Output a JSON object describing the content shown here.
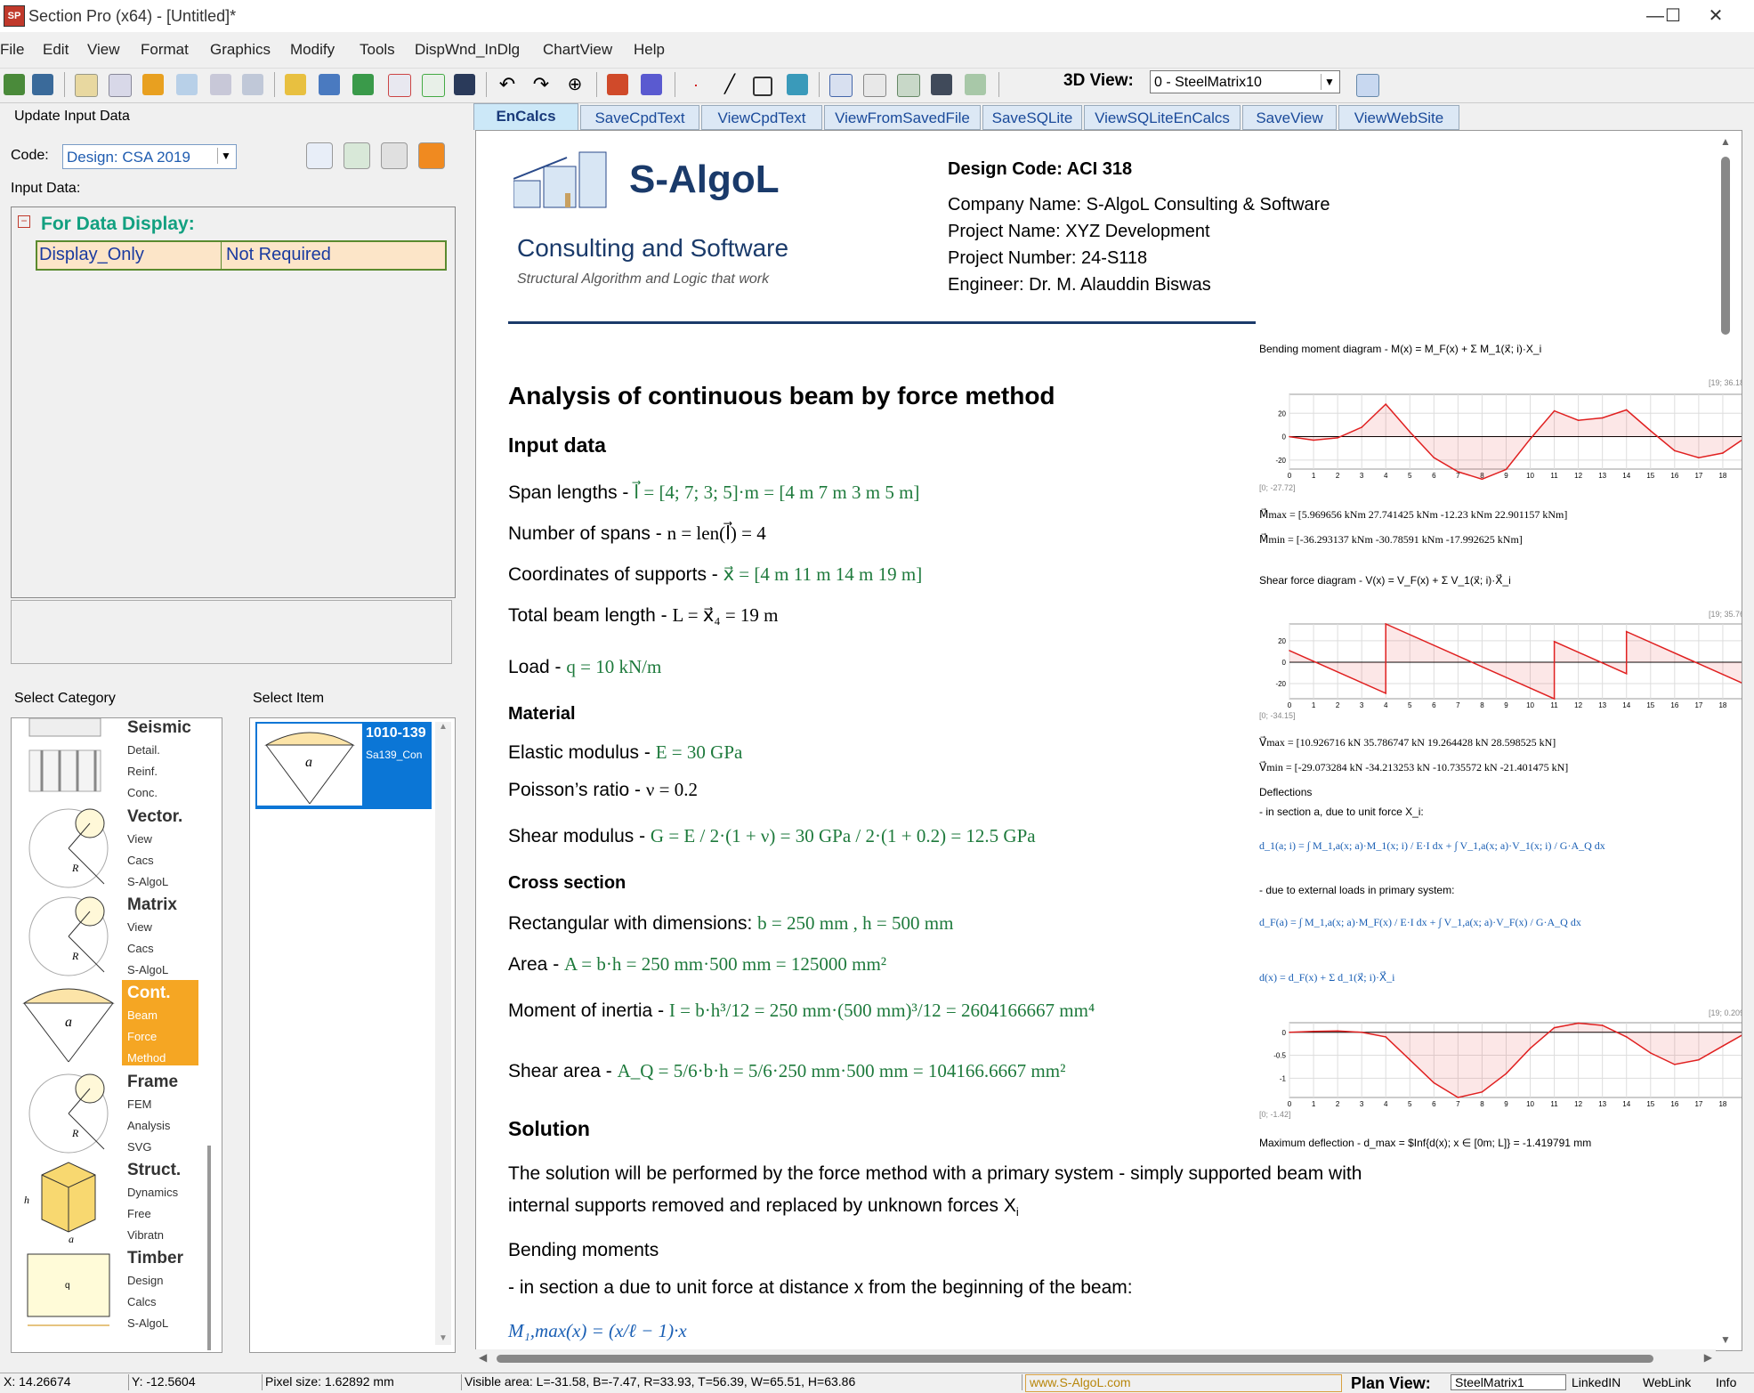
{
  "window": {
    "title": "Section Pro (x64) - [Untitled]*",
    "app_icon_text": "SP",
    "minimize": "—",
    "maximize": "☐",
    "close": "✕"
  },
  "menu": [
    "File",
    "Edit",
    "View",
    "Format",
    "Graphics",
    "Modify",
    "Tools",
    "DispWnd_InDlg",
    "ChartView",
    "Help"
  ],
  "toolbar": {
    "view3d_label": "3D View:",
    "view3d_value": "0 - SteelMatrix10"
  },
  "left": {
    "update_label": "Update Input Data",
    "code_label": "Code:",
    "code_value": "Design: CSA 2019",
    "input_data_label": "Input Data:",
    "grid_title": "For Data Display:",
    "grid_collapse": "−",
    "grid_row": [
      "Display_Only",
      "Not Required"
    ],
    "category_label": "Select Category",
    "item_label": "Select Item",
    "categories": [
      {
        "title": "Seismic",
        "lines": [
          "Detail.",
          "Reinf.",
          "Conc."
        ]
      },
      {
        "title": "Vector.",
        "lines": [
          "View",
          "Cacs",
          "S-AlgoL"
        ]
      },
      {
        "title": "Matrix",
        "lines": [
          "View",
          "Cacs",
          "S-AlgoL"
        ]
      },
      {
        "title": "Cont.",
        "lines": [
          "Beam",
          "Force",
          "Method"
        ]
      },
      {
        "title": "Frame",
        "lines": [
          "FEM",
          "Analysis",
          "SVG"
        ]
      },
      {
        "title": "Struct.",
        "lines": [
          "Dynamics",
          "Free",
          "Vibratn"
        ]
      },
      {
        "title": "Timber",
        "lines": [
          "Design",
          "Calcs",
          "S-AlgoL"
        ]
      }
    ],
    "selected_item": {
      "title": "1010-139",
      "sub": "Sa139_Con"
    }
  },
  "tabs": [
    "EnCalcs",
    "SaveCpdText",
    "ViewCpdText",
    "ViewFromSavedFile",
    "SaveSQLite",
    "ViewSQLiteEnCalcs",
    "SaveView",
    "ViewWebSite"
  ],
  "doc": {
    "logo": {
      "name": "S-AlgoL",
      "line2": "Consulting and Software",
      "tagline": "Structural Algorithm and Logic that work"
    },
    "header": {
      "design_code": "Design Code: ACI 318",
      "company": "Company Name: S-AlgoL Consulting & Software",
      "project": "Project Name: XYZ Development",
      "number": "Project Number: 24-S118",
      "engineer": "Engineer: Dr. M. Alauddin Biswas"
    },
    "title": "Analysis of continuous beam by force method",
    "input_heading": "Input data",
    "span_label": "Span lengths - ",
    "span_formula": "l⃗ = [4; 7; 3; 5]·m = [4 m  7 m  3 m  5 m]",
    "nspans_label": "Number of spans - ",
    "nspans_formula": "n = len(l⃗) = 4",
    "coords_label": "Coordinates of supports - ",
    "coords_formula": "x⃗ = [4 m  11 m  14 m  19 m]",
    "total_label": "Total beam length - ",
    "total_formula": "L = x⃗₄ = 19 m",
    "load_label": "Load - ",
    "load_formula": "q = 10 kN/m",
    "material_heading": "Material",
    "elastic_label": "Elastic modulus - ",
    "elastic_formula": "E = 30 GPa",
    "poisson_label": "Poisson’s ratio - ",
    "poisson_formula": "ν = 0.2",
    "shear_label": "Shear modulus - ",
    "shear_formula": "G = E / 2·(1 + ν) = 30 GPa / 2·(1 + 0.2) = 12.5 GPa",
    "cross_heading": "Cross section",
    "rect_label": "Rectangular with dimensions: ",
    "rect_formula": "b = 250 mm ,  h = 500 mm",
    "area_label": "Area - ",
    "area_formula": "A = b·h = 250 mm·500 mm = 125000 mm²",
    "inertia_label": "Moment of inertia - ",
    "inertia_formula": "I = b·h³/12 = 250 mm·(500 mm)³/12 = 2604166667 mm⁴",
    "sharea_label": "Shear area - ",
    "sharea_formula": "A_Q = 5/6·b·h = 5/6·250 mm·500 mm = 104166.6667 mm²",
    "solution_heading": "Solution",
    "solution_p1": "The solution will be performed by the force method with a primary system - simply supported beam with",
    "solution_p2": "internal supports removed and replaced by unknown forces X",
    "solution_p2_sub": "i",
    "bending_label": "Bending moments",
    "section_label": "- in section a due to unit force at distance x from the beginning of the beam:",
    "m1_formula": "M₁,max(x) = (x/ℓ − 1)·x",
    "right": {
      "bm_caption": "Bending moment diagram - M(x) = M_F(x) + Σ M_1(x⃗; i)·X_i",
      "bm_top": "[19; 36.18]",
      "bm_bottom": "[0; -27.72]",
      "mmax": "M⃗max = [5.969656 kNm  27.741425 kNm  -12.23 kNm  22.901157 kNm]",
      "mmin": "M⃗min = [-36.293137 kNm  -30.78591 kNm  -17.992625 kNm]",
      "sf_caption": "Shear force diagram - V(x) = V_F(x) + Σ V_1(x⃗; i)·X⃗_i",
      "sf_top": "[19; 35.76]",
      "sf_bottom": "[0; -34.15]",
      "vmax": "V⃗max = [10.926716 kN  35.786747 kN  19.264428 kN  28.598525 kN]",
      "vmin": "V⃗min = [-29.073284 kN  -34.213253 kN  -10.735572 kN  -21.401475 kN]",
      "defl_heading": "Deflections",
      "defl_sub1": "- in section a, due to unit force X_i:",
      "d1_formula": "d_1(a; i) = ∫ M_1,a(x; a)·M_1(x; i) / E·I dx + ∫ V_1,a(x; a)·V_1(x; i) / G·A_Q dx",
      "defl_sub2": "- due to external loads in primary system:",
      "dF_formula": "d_F(a) = ∫ M_1,a(x; a)·M_F(x) / E·I dx + ∫ V_1,a(x; a)·V_F(x) / G·A_Q dx",
      "dx_formula": "d(x) = d_F(x) + Σ d_1(x⃗; i)·X⃗_i",
      "dd_top": "[19; 0.209]",
      "dd_bottom": "[0; -1.42]",
      "maxdefl": "Maximum deflection - d_max = $Inf{d(x); x ∈ [0m; L]} = -1.419791 mm"
    }
  },
  "chart_data": [
    {
      "type": "line",
      "title": "Bending moment diagram",
      "x": [
        0,
        1,
        2,
        3,
        4,
        5,
        6,
        7,
        8,
        9,
        10,
        11,
        12,
        13,
        14,
        15,
        16,
        17,
        18,
        19
      ],
      "values": [
        0,
        -3,
        -1,
        8,
        27.7,
        4,
        -18,
        -30,
        -36.3,
        -28,
        -2,
        22,
        14,
        16,
        22.9,
        5,
        -12,
        -18,
        -14,
        0
      ],
      "xlim": [
        0,
        19
      ],
      "ylim": [
        -27.72,
        36.18
      ],
      "ylabel": "y",
      "xlabel": "x",
      "yticks": [
        20,
        0,
        -20
      ]
    },
    {
      "type": "line",
      "title": "Shear force diagram",
      "x": [
        0,
        4,
        4,
        11,
        11,
        14,
        14,
        19
      ],
      "values": [
        10.9,
        -29.1,
        35.8,
        -34.2,
        19.3,
        -10.7,
        28.6,
        -21.4
      ],
      "xlim": [
        0,
        19
      ],
      "ylim": [
        -34.15,
        35.76
      ],
      "yticks": [
        20,
        0,
        -20
      ]
    },
    {
      "type": "line",
      "title": "Deflection",
      "x": [
        0,
        1,
        2,
        3,
        4,
        5,
        6,
        7,
        8,
        9,
        10,
        11,
        12,
        13,
        14,
        15,
        16,
        17,
        18,
        19
      ],
      "values": [
        0,
        0.02,
        0.03,
        0.0,
        -0.1,
        -0.6,
        -1.1,
        -1.42,
        -1.3,
        -0.9,
        -0.35,
        0.1,
        0.2,
        0.15,
        -0.1,
        -0.45,
        -0.7,
        -0.6,
        -0.3,
        0
      ],
      "xlim": [
        0,
        19
      ],
      "ylim": [
        -1.42,
        0.209
      ],
      "yticks": [
        0,
        -0.5,
        -1
      ]
    }
  ],
  "status": {
    "x": "X: 14.26674",
    "y": "Y: -12.5604",
    "pixel": "Pixel size: 1.62892 mm",
    "visible": "Visible area:  L=-31.58, B=-7.47, R=33.93, T=56.39,  W=65.51, H=63.86",
    "web": "www.S-AlgoL.com",
    "plan_label": "Plan View:",
    "plan_value": "SteelMatrix1",
    "linkedin": "LinkedIN",
    "weblink": "WebLink",
    "info": "Info"
  }
}
